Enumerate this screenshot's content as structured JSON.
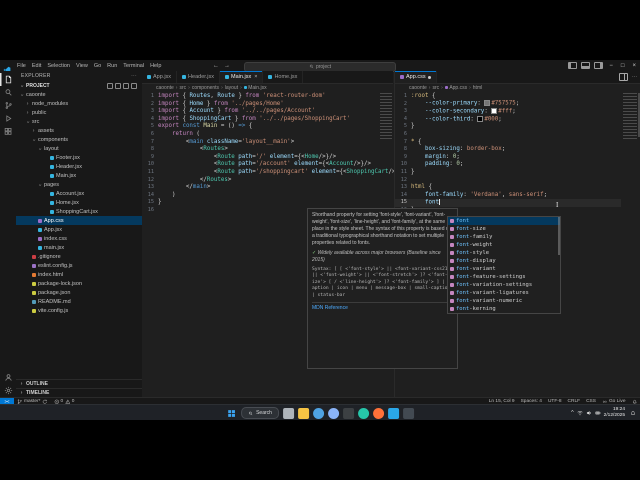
{
  "colors": {
    "accent": "#0078d4",
    "selection": "#04395e",
    "filetypes": {
      "jsx": "#35b5e0",
      "css": "#9b6dc8",
      "js": "#cbcb41",
      "html": "#e37933",
      "json": "#cbcb41",
      "md": "#529ab8",
      "git": "#cc3e44",
      "eslint": "#9b72c6"
    }
  },
  "titlebar": {
    "menus": [
      "File",
      "Edit",
      "Selection",
      "View",
      "Go",
      "Run",
      "Terminal",
      "Help"
    ],
    "search_value": "project"
  },
  "activity_bar": {
    "top": [
      "explorer",
      "search",
      "source-control",
      "run-debug",
      "extensions"
    ],
    "bottom": [
      "account",
      "settings"
    ],
    "active": "explorer"
  },
  "explorer": {
    "title": "EXPLORER",
    "section": "PROJECT",
    "outline_label": "OUTLINE",
    "timeline_label": "TIMELINE",
    "items": [
      {
        "label": "caoonte",
        "indent": 0,
        "type": "folder",
        "expanded": true
      },
      {
        "label": "node_modules",
        "indent": 1,
        "type": "folder",
        "expanded": false
      },
      {
        "label": "public",
        "indent": 1,
        "type": "folder",
        "expanded": false
      },
      {
        "label": "src",
        "indent": 1,
        "type": "folder",
        "expanded": true
      },
      {
        "label": "assets",
        "indent": 2,
        "type": "folder",
        "expanded": false
      },
      {
        "label": "components",
        "indent": 2,
        "type": "folder",
        "expanded": true
      },
      {
        "label": "layout",
        "indent": 3,
        "type": "folder",
        "expanded": true
      },
      {
        "label": "Footer.jsx",
        "indent": 4,
        "type": "file",
        "icon": "#35b5e0"
      },
      {
        "label": "Header.jsx",
        "indent": 4,
        "type": "file",
        "icon": "#35b5e0"
      },
      {
        "label": "Main.jsx",
        "indent": 4,
        "type": "file",
        "icon": "#35b5e0"
      },
      {
        "label": "pages",
        "indent": 3,
        "type": "folder",
        "expanded": true
      },
      {
        "label": "Account.jsx",
        "indent": 4,
        "type": "file",
        "icon": "#35b5e0"
      },
      {
        "label": "Home.jsx",
        "indent": 4,
        "type": "file",
        "icon": "#35b5e0"
      },
      {
        "label": "ShoppingCart.jsx",
        "indent": 4,
        "type": "file",
        "icon": "#35b5e0"
      },
      {
        "label": "App.css",
        "indent": 2,
        "type": "file",
        "icon": "#9b6dc8",
        "selected": true
      },
      {
        "label": "App.jsx",
        "indent": 2,
        "type": "file",
        "icon": "#35b5e0"
      },
      {
        "label": "index.css",
        "indent": 2,
        "type": "file",
        "icon": "#9b6dc8"
      },
      {
        "label": "main.jsx",
        "indent": 2,
        "type": "file",
        "icon": "#35b5e0"
      },
      {
        "label": ".gitignore",
        "indent": 1,
        "type": "file",
        "icon": "#cc3e44"
      },
      {
        "label": "eslint.config.js",
        "indent": 1,
        "type": "file",
        "icon": "#9b72c6"
      },
      {
        "label": "index.html",
        "indent": 1,
        "type": "file",
        "icon": "#e37933"
      },
      {
        "label": "package-lock.json",
        "indent": 1,
        "type": "file",
        "icon": "#cbcb41"
      },
      {
        "label": "package.json",
        "indent": 1,
        "type": "file",
        "icon": "#cbcb41"
      },
      {
        "label": "README.md",
        "indent": 1,
        "type": "file",
        "icon": "#529ab8"
      },
      {
        "label": "vite.config.js",
        "indent": 1,
        "type": "file",
        "icon": "#cbcb41"
      }
    ]
  },
  "left_editor": {
    "tabs": [
      {
        "label": "App.jsx",
        "color": "#35b5e0"
      },
      {
        "label": "Header.jsx",
        "color": "#35b5e0"
      },
      {
        "label": "Main.jsx",
        "color": "#35b5e0",
        "active": true,
        "close": true
      },
      {
        "label": "Home.jsx",
        "color": "#35b5e0"
      }
    ],
    "breadcrumb": [
      "caoonte",
      "src",
      "components",
      "layout",
      "Main.jsx"
    ],
    "lines": [
      [
        {
          "t": "import",
          "c": "kw"
        },
        {
          "t": " { ",
          "c": "pun"
        },
        {
          "t": "Routes",
          "c": "var"
        },
        {
          "t": ", ",
          "c": "pun"
        },
        {
          "t": "Route",
          "c": "var"
        },
        {
          "t": " } ",
          "c": "pun"
        },
        {
          "t": "from",
          "c": "kw"
        },
        {
          "t": " ",
          "c": "pun"
        },
        {
          "t": "'react-router-dom'",
          "c": "str"
        }
      ],
      [
        {
          "t": "import",
          "c": "kw"
        },
        {
          "t": " { ",
          "c": "pun"
        },
        {
          "t": "Home",
          "c": "var"
        },
        {
          "t": " } ",
          "c": "pun"
        },
        {
          "t": "from",
          "c": "kw"
        },
        {
          "t": " ",
          "c": "pun"
        },
        {
          "t": "'../pages/Home'",
          "c": "str"
        }
      ],
      [
        {
          "t": "import",
          "c": "kw"
        },
        {
          "t": " { ",
          "c": "pun"
        },
        {
          "t": "Account",
          "c": "var"
        },
        {
          "t": " } ",
          "c": "pun"
        },
        {
          "t": "from",
          "c": "kw"
        },
        {
          "t": " ",
          "c": "pun"
        },
        {
          "t": "'../../pages/Account'",
          "c": "str"
        }
      ],
      [
        {
          "t": "import",
          "c": "kw"
        },
        {
          "t": " { ",
          "c": "pun"
        },
        {
          "t": "ShoppingCart",
          "c": "var"
        },
        {
          "t": " } ",
          "c": "pun"
        },
        {
          "t": "from",
          "c": "kw"
        },
        {
          "t": " ",
          "c": "pun"
        },
        {
          "t": "'../../pages/ShoppingCart'",
          "c": "str"
        }
      ],
      [
        {
          "t": "export",
          "c": "kw"
        },
        {
          "t": " ",
          "c": "pun"
        },
        {
          "t": "const",
          "c": "kw2"
        },
        {
          "t": " ",
          "c": "pun"
        },
        {
          "t": "Main",
          "c": "fn"
        },
        {
          "t": " = () ",
          "c": "pun"
        },
        {
          "t": "=>",
          "c": "kw2"
        },
        {
          "t": " {",
          "c": "pun"
        }
      ],
      [
        {
          "t": "    ",
          "c": "pun"
        },
        {
          "t": "return",
          "c": "kw"
        },
        {
          "t": " (",
          "c": "pun"
        }
      ],
      [
        {
          "t": "        <",
          "c": "pun"
        },
        {
          "t": "main",
          "c": "tag"
        },
        {
          "t": " ",
          "c": "pun"
        },
        {
          "t": "className",
          "c": "attr"
        },
        {
          "t": "=",
          "c": "pun"
        },
        {
          "t": "'layout__main'",
          "c": "str"
        },
        {
          "t": ">",
          "c": "pun"
        }
      ],
      [
        {
          "t": "            <",
          "c": "pun"
        },
        {
          "t": "Routes",
          "c": "comp"
        },
        {
          "t": ">",
          "c": "pun"
        }
      ],
      [
        {
          "t": "                <",
          "c": "pun"
        },
        {
          "t": "Route",
          "c": "comp"
        },
        {
          "t": " ",
          "c": "pun"
        },
        {
          "t": "path",
          "c": "attr"
        },
        {
          "t": "=",
          "c": "pun"
        },
        {
          "t": "'/'",
          "c": "str"
        },
        {
          "t": " ",
          "c": "pun"
        },
        {
          "t": "element",
          "c": "attr"
        },
        {
          "t": "={<",
          "c": "pun"
        },
        {
          "t": "Home",
          "c": "comp"
        },
        {
          "t": "/>}/>",
          "c": "pun"
        }
      ],
      [
        {
          "t": "                <",
          "c": "pun"
        },
        {
          "t": "Route",
          "c": "comp"
        },
        {
          "t": " ",
          "c": "pun"
        },
        {
          "t": "path",
          "c": "attr"
        },
        {
          "t": "=",
          "c": "pun"
        },
        {
          "t": "'/account'",
          "c": "str"
        },
        {
          "t": " ",
          "c": "pun"
        },
        {
          "t": "element",
          "c": "attr"
        },
        {
          "t": "={<",
          "c": "pun"
        },
        {
          "t": "Account",
          "c": "comp"
        },
        {
          "t": "/>}/>",
          "c": "pun"
        }
      ],
      [
        {
          "t": "                <",
          "c": "pun"
        },
        {
          "t": "Route",
          "c": "comp"
        },
        {
          "t": " ",
          "c": "pun"
        },
        {
          "t": "path",
          "c": "attr"
        },
        {
          "t": "=",
          "c": "pun"
        },
        {
          "t": "'/shoppingcart'",
          "c": "str"
        },
        {
          "t": " ",
          "c": "pun"
        },
        {
          "t": "element",
          "c": "attr"
        },
        {
          "t": "={<",
          "c": "pun"
        },
        {
          "t": "ShoppingCart",
          "c": "comp"
        },
        {
          "t": "/>}/>",
          "c": "pun"
        }
      ],
      [
        {
          "t": "            </",
          "c": "pun"
        },
        {
          "t": "Routes",
          "c": "comp"
        },
        {
          "t": ">",
          "c": "pun"
        }
      ],
      [
        {
          "t": "        </",
          "c": "pun"
        },
        {
          "t": "main",
          "c": "tag"
        },
        {
          "t": ">",
          "c": "pun"
        }
      ],
      [
        {
          "t": "    )",
          "c": "pun"
        }
      ],
      [
        {
          "t": "}",
          "c": "pun"
        }
      ],
      []
    ]
  },
  "right_editor": {
    "tabs": [
      {
        "label": "App.css",
        "color": "#9b6dc8",
        "active": true,
        "modified": true
      }
    ],
    "breadcrumb": [
      "caoonte",
      "src",
      "App.css",
      "html"
    ],
    "active_line": 15,
    "lines": [
      [
        {
          "t": ":root",
          "c": "sel"
        },
        {
          "t": " {",
          "c": "pun"
        }
      ],
      [
        {
          "t": "    ",
          "c": "pun"
        },
        {
          "t": "--color-primary",
          "c": "prop"
        },
        {
          "t": ": ",
          "c": "pun"
        },
        {
          "swatch": "#757575"
        },
        {
          "t": "#757575",
          "c": "val"
        },
        {
          "t": ";",
          "c": "pun"
        }
      ],
      [
        {
          "t": "    ",
          "c": "pun"
        },
        {
          "t": "--color-secondary",
          "c": "prop"
        },
        {
          "t": ": ",
          "c": "pun"
        },
        {
          "swatch": "#ffffff"
        },
        {
          "t": "#fff",
          "c": "val"
        },
        {
          "t": ";",
          "c": "pun"
        }
      ],
      [
        {
          "t": "    ",
          "c": "pun"
        },
        {
          "t": "--color-third",
          "c": "prop"
        },
        {
          "t": ": ",
          "c": "pun"
        },
        {
          "swatch": "#000000"
        },
        {
          "t": "#000",
          "c": "val"
        },
        {
          "t": ";",
          "c": "pun"
        }
      ],
      [
        {
          "t": "}",
          "c": "pun"
        }
      ],
      [],
      [
        {
          "t": "*",
          "c": "sel"
        },
        {
          "t": " {",
          "c": "pun"
        }
      ],
      [
        {
          "t": "    ",
          "c": "pun"
        },
        {
          "t": "box-sizing",
          "c": "prop"
        },
        {
          "t": ": ",
          "c": "pun"
        },
        {
          "t": "border-box",
          "c": "val"
        },
        {
          "t": ";",
          "c": "pun"
        }
      ],
      [
        {
          "t": "    ",
          "c": "pun"
        },
        {
          "t": "margin",
          "c": "prop"
        },
        {
          "t": ": ",
          "c": "pun"
        },
        {
          "t": "0",
          "c": "num"
        },
        {
          "t": ";",
          "c": "pun"
        }
      ],
      [
        {
          "t": "    ",
          "c": "pun"
        },
        {
          "t": "padding",
          "c": "prop"
        },
        {
          "t": ": ",
          "c": "pun"
        },
        {
          "t": "0",
          "c": "num"
        },
        {
          "t": ";",
          "c": "pun"
        }
      ],
      [
        {
          "t": "}",
          "c": "pun"
        }
      ],
      [],
      [
        {
          "t": "html",
          "c": "sel"
        },
        {
          "t": " {",
          "c": "pun"
        }
      ],
      [
        {
          "t": "    ",
          "c": "pun"
        },
        {
          "t": "font-family",
          "c": "prop"
        },
        {
          "t": ": ",
          "c": "pun"
        },
        {
          "t": "'Verdana'",
          "c": "str"
        },
        {
          "t": ", ",
          "c": "pun"
        },
        {
          "t": "sans-serif",
          "c": "val"
        },
        {
          "t": ";",
          "c": "pun"
        }
      ],
      [
        {
          "t": "    ",
          "c": "pun"
        },
        {
          "t": "font",
          "c": "prop"
        },
        {
          "caret": true
        }
      ],
      [
        {
          "t": "}",
          "c": "pun"
        }
      ]
    ]
  },
  "suggest": {
    "match": "font",
    "selected_index": 0,
    "items": [
      "font",
      "font-size",
      "font-family",
      "font-weight",
      "font-style",
      "font-display",
      "font-variant",
      "font-feature-settings",
      "font-variation-settings",
      "font-variant-ligatures",
      "font-variant-numeric",
      "font-kerning"
    ]
  },
  "doc": {
    "description": "Shorthand property for setting 'font-style', 'font-variant', 'font-weight', 'font-size', 'line-height', and 'font-family', at the same place in the style sheet. The syntax of this property is based on a traditional typographical shorthand notation to set multiple properties related to fonts.",
    "baseline_check": "✓",
    "baseline": "Widely available across major browsers (Baseline since 2015)",
    "syntax": "Syntax: [ [ <'font-style'> || <font-variant-css21> || <'font-weight'> || <'font-stretch'> ]? <'font-size'> [ / <'line-height'> ]? <'font-family'> ] | caption | icon | menu | message-box | small-caption | status-bar",
    "link": "MDN Reference"
  },
  "status_bar": {
    "remote": "><",
    "branch": "master*",
    "errors": "0",
    "warnings": "0",
    "line_col": "Ln 15, Col 9",
    "spaces": "Spaces: 4",
    "encoding": "UTF-8",
    "eol": "CRLF",
    "language": "CSS",
    "go_live": "Go Live"
  },
  "taskbar": {
    "search_label": "Search",
    "time": "19:24",
    "date": "2/12/2025",
    "apps": [
      {
        "name": "task-view",
        "color": "#aeb4ba",
        "shape": "square"
      },
      {
        "name": "file-explorer",
        "color": "#f6c444",
        "shape": "square"
      },
      {
        "name": "app-blue",
        "color": "#4fa3e3",
        "shape": "circle"
      },
      {
        "name": "chrome",
        "color": "#8ab4f8",
        "shape": "circle"
      },
      {
        "name": "app-dark",
        "color": "#3c4043",
        "shape": "square"
      },
      {
        "name": "app-teal",
        "color": "#26c6aa",
        "shape": "circle"
      },
      {
        "name": "firefox",
        "color": "#ff7139",
        "shape": "circle"
      },
      {
        "name": "vscode",
        "color": "#2aa7e8",
        "shape": "square"
      },
      {
        "name": "app-dark-2",
        "color": "#424a52",
        "shape": "square"
      }
    ]
  }
}
